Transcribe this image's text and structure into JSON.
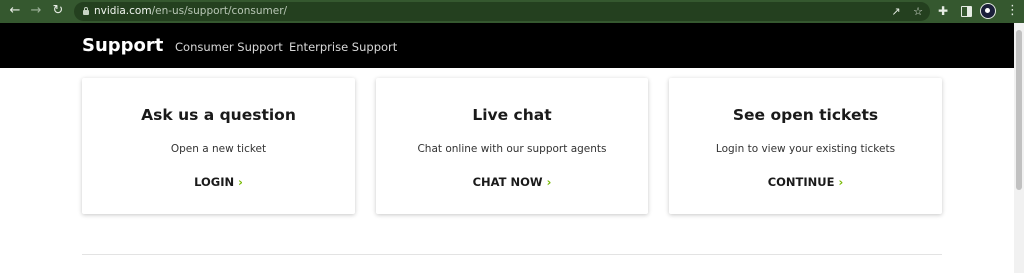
{
  "browser": {
    "url_host": "nvidia.com",
    "url_path": "/en-us/support/consumer/",
    "icons": [
      "back-icon",
      "forward-icon",
      "reload-icon",
      "lock-icon",
      "share-icon",
      "star-icon",
      "extensions-icon",
      "side-panel-icon",
      "profile-avatar",
      "menu-icon"
    ]
  },
  "header": {
    "brand": "Support",
    "nav": [
      "Consumer Support",
      "Enterprise Support"
    ]
  },
  "cards": [
    {
      "title": "Ask us a question",
      "description": "Open a new ticket",
      "link": "LOGIN"
    },
    {
      "title": "Live chat",
      "description": "Chat online with our support agents",
      "link": "CHAT NOW"
    },
    {
      "title": "See open tickets",
      "description": "Login to view your existing tickets",
      "link": "CONTINUE"
    }
  ],
  "colors": {
    "browser_bar": "#35582f",
    "header_bg": "#000000",
    "accent": "#76b900"
  }
}
